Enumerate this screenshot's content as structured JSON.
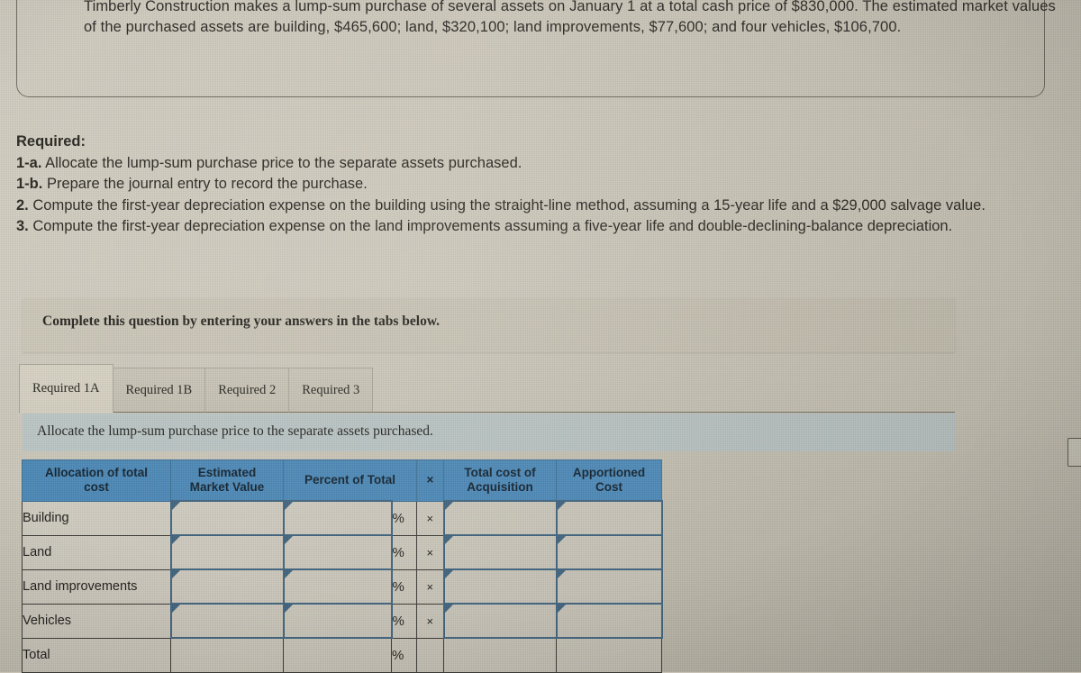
{
  "question": {
    "text": "Timberly Construction makes a lump-sum purchase of several assets on January 1 at a total cash price of $830,000. The estimated market values of the purchased assets are building, $465,600; land, $320,100; land improvements, $77,600; and four vehicles, $106,700."
  },
  "required": {
    "title": "Required:",
    "items": [
      {
        "label": "1-a.",
        "text": "Allocate the lump-sum purchase price to the separate assets purchased."
      },
      {
        "label": "1-b.",
        "text": "Prepare the journal entry to record the purchase."
      },
      {
        "label": "2.",
        "text": "Compute the first-year depreciation expense on the building using the straight-line method, assuming a 15-year life and a $29,000 salvage value."
      },
      {
        "label": "3.",
        "text": "Compute the first-year depreciation expense on the land improvements assuming a five-year life and double-declining-balance depreciation."
      }
    ]
  },
  "banner": {
    "text": "Complete this question by entering your answers in the tabs below."
  },
  "tabs": {
    "items": [
      {
        "label": "Required 1A",
        "active": true
      },
      {
        "label": "Required 1B",
        "active": false
      },
      {
        "label": "Required 2",
        "active": false
      },
      {
        "label": "Required 3",
        "active": false
      }
    ]
  },
  "instruction": {
    "text": "Allocate the lump-sum purchase price to the separate assets purchased."
  },
  "table": {
    "headers": [
      "Allocation of total cost",
      "Estimated Market Value",
      "Percent of Total",
      "×",
      "Total cost of Acquisition",
      "Apportioned Cost"
    ],
    "header_line1": [
      "Allocation of total",
      "Estimated",
      "Percent of Total",
      "×",
      "Total cost of",
      "Apportioned"
    ],
    "header_line2": [
      "cost",
      "Market Value",
      "",
      "",
      "Acquisition",
      "Cost"
    ],
    "percent_symbol": "%",
    "times_symbol": "×",
    "rows": [
      {
        "label": "Building",
        "estimated_market_value": "",
        "percent_of_total": "",
        "percent_suffix": "%",
        "times": "×",
        "total_cost_of_acquisition": "",
        "apportioned_cost": ""
      },
      {
        "label": "Land",
        "estimated_market_value": "",
        "percent_of_total": "",
        "percent_suffix": "%",
        "times": "×",
        "total_cost_of_acquisition": "",
        "apportioned_cost": ""
      },
      {
        "label": "Land improvements",
        "estimated_market_value": "",
        "percent_of_total": "",
        "percent_suffix": "%",
        "times": "×",
        "total_cost_of_acquisition": "",
        "apportioned_cost": ""
      },
      {
        "label": "Vehicles",
        "estimated_market_value": "",
        "percent_of_total": "",
        "percent_suffix": "%",
        "times": "×",
        "total_cost_of_acquisition": "",
        "apportioned_cost": ""
      },
      {
        "label": "Total",
        "estimated_market_value": "",
        "percent_of_total": "",
        "percent_suffix": "%",
        "times": "",
        "total_cost_of_acquisition": "",
        "apportioned_cost": ""
      }
    ]
  },
  "colors": {
    "table_header_blue": "#4a87b5",
    "input_border_blue": "#3f637d",
    "instruction_bar": "#b6c0bf",
    "page_background": "#cbc6b8"
  }
}
